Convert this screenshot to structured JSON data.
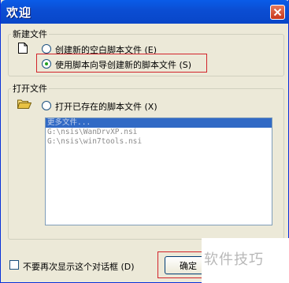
{
  "window": {
    "title": "欢迎",
    "close_icon": "close-icon"
  },
  "new_group": {
    "legend": "新建文件",
    "icon": "blank-document-icon",
    "options": [
      {
        "label": "创建新的空白脚本文件 (E)",
        "selected": false
      },
      {
        "label": "使用脚本向导创建新的脚本文件 (S)",
        "selected": true
      }
    ]
  },
  "open_group": {
    "legend": "打开文件",
    "icon": "open-folder-icon",
    "option": {
      "label": "打开已存在的脚本文件 (X)",
      "selected": false
    },
    "files": [
      {
        "name": "更多文件...",
        "selected": true
      },
      {
        "name": "G:\\nsis\\WanDrvXP.nsi",
        "selected": false
      },
      {
        "name": "G:\\nsis\\win7tools.nsi",
        "selected": false
      }
    ]
  },
  "footer": {
    "dont_show_label": "不要再次显示这个对话框 (D)",
    "dont_show_checked": false,
    "ok_label": "确定"
  },
  "watermark": "软件技巧",
  "colors": {
    "titlebar": "#0b4dd2",
    "highlight_border": "#d2232a",
    "dialog_bg": "#ece9d8",
    "selection": "#316ac5"
  }
}
